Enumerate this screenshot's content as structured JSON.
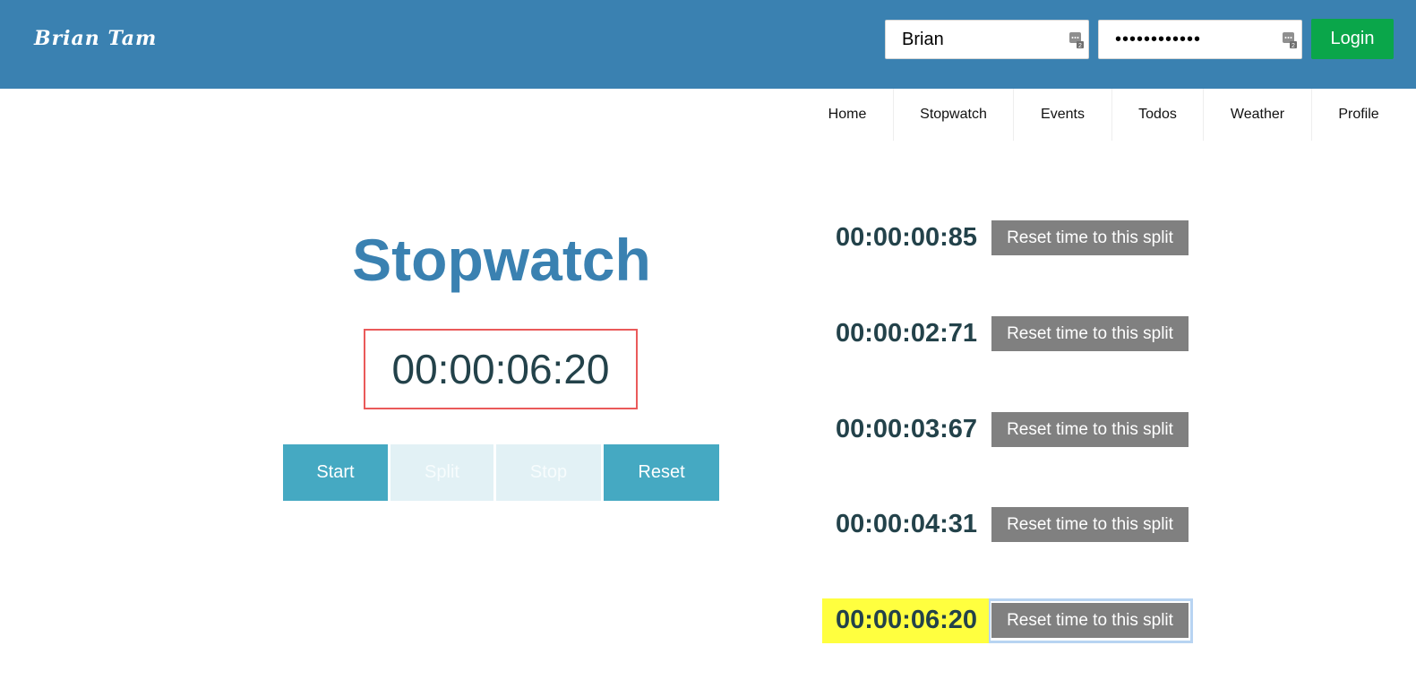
{
  "header": {
    "brand": "Brian Tam",
    "username_value": "Brian",
    "password_value": "••••••••••••",
    "login_label": "Login",
    "color": "#3a81b1",
    "login_color": "#0aa64a"
  },
  "nav": {
    "items": [
      {
        "label": "Home"
      },
      {
        "label": "Stopwatch"
      },
      {
        "label": "Events"
      },
      {
        "label": "Todos"
      },
      {
        "label": "Weather"
      },
      {
        "label": "Profile"
      }
    ]
  },
  "stopwatch": {
    "title": "Stopwatch",
    "time": "00:00:06:20",
    "buttons": {
      "start": "Start",
      "split": "Split",
      "stop": "Stop",
      "reset": "Reset"
    },
    "split_enabled": false,
    "stop_enabled": false
  },
  "splits": [
    {
      "time": "00:00:00:85",
      "action": "Reset time to this split"
    },
    {
      "time": "00:00:02:71",
      "action": "Reset time to this split"
    },
    {
      "time": "00:00:03:67",
      "action": "Reset time to this split"
    },
    {
      "time": "00:00:04:31",
      "action": "Reset time to this split"
    },
    {
      "time": "00:00:06:20",
      "action": "Reset time to this split",
      "highlighted": true
    }
  ]
}
